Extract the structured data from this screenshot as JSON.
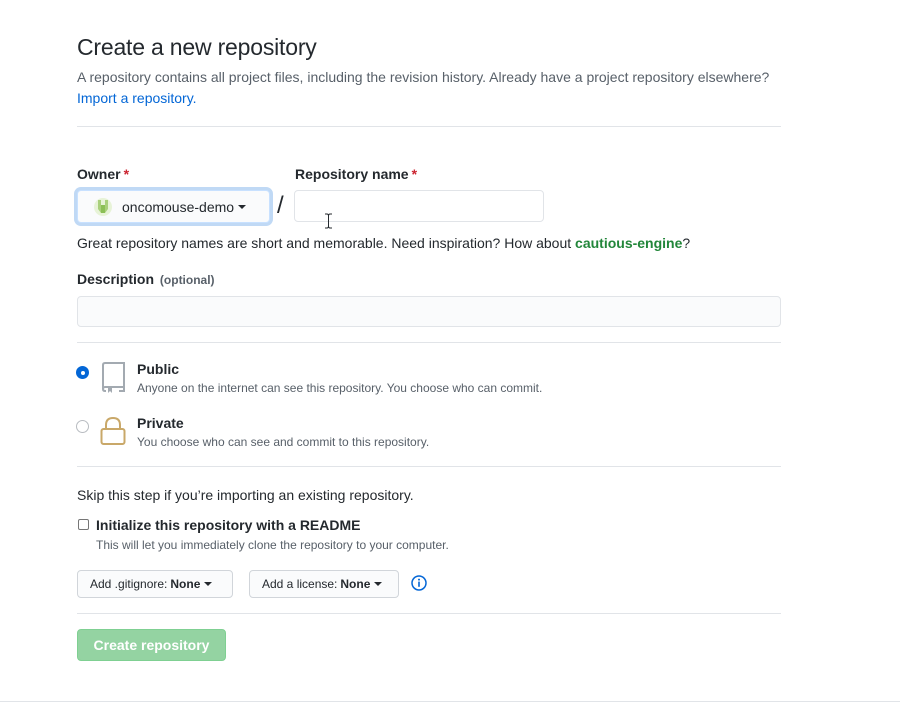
{
  "header": {
    "title": "Create a new repository",
    "subtitle": "A repository contains all project files, including the revision history. Already have a project repository elsewhere?",
    "import_link": "Import a repository."
  },
  "owner": {
    "label": "Owner",
    "required_mark": "*",
    "value": "oncomouse-demo"
  },
  "repo_name": {
    "label": "Repository name",
    "required_mark": "*",
    "value": "",
    "separator": "/"
  },
  "hint": {
    "text": "Great repository names are short and memorable. Need inspiration? How about",
    "suggestion": "cautious-engine",
    "suffix": "?"
  },
  "description": {
    "label": "Description",
    "optional": "(optional)",
    "value": ""
  },
  "visibility": {
    "options": [
      {
        "title": "Public",
        "desc": "Anyone on the internet can see this repository. You choose who can commit.",
        "checked": true,
        "icon": "repo-icon"
      },
      {
        "title": "Private",
        "desc": "You choose who can see and commit to this repository.",
        "checked": false,
        "icon": "lock-icon"
      }
    ]
  },
  "init": {
    "skip_text": "Skip this step if you’re importing an existing repository.",
    "readme_label": "Initialize this repository with a README",
    "readme_note": "This will let you immediately clone the repository to your computer.",
    "readme_checked": false
  },
  "selects": {
    "gitignore_prefix": "Add .gitignore:",
    "gitignore_value": "None",
    "license_prefix": "Add a license:",
    "license_value": "None"
  },
  "submit": {
    "label": "Create repository"
  },
  "colors": {
    "link": "#0366d6",
    "suggestion": "#22863a",
    "required": "#cb2431",
    "button_disabled": "#94d3a2"
  }
}
